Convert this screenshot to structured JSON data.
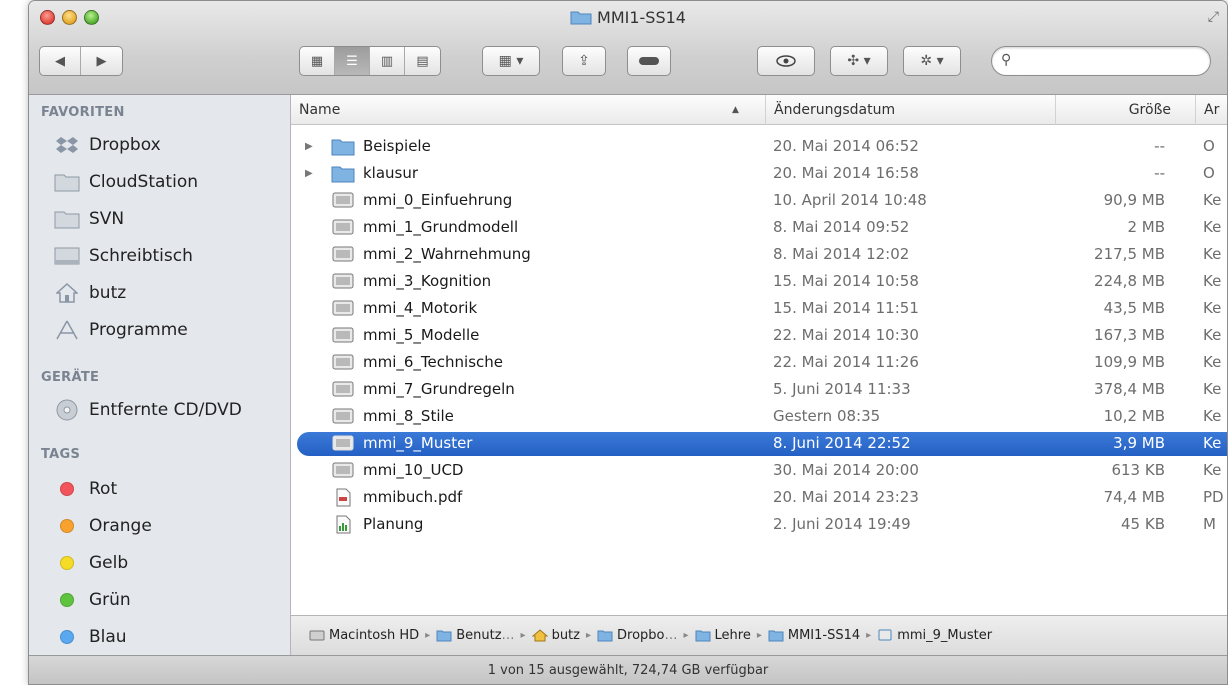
{
  "window": {
    "title": "MMI1-SS14"
  },
  "search": {
    "value": "",
    "placeholder": ""
  },
  "sidebar": {
    "sections": {
      "favorites": "FAVORITEN",
      "devices": "GERÄTE",
      "tags": "TAGS"
    },
    "favorites": [
      {
        "label": "Dropbox",
        "icon": "dropbox-icon"
      },
      {
        "label": "CloudStation",
        "icon": "folder-icon"
      },
      {
        "label": "SVN",
        "icon": "folder-icon"
      },
      {
        "label": "Schreibtisch",
        "icon": "desktop-icon"
      },
      {
        "label": "butz",
        "icon": "home-icon"
      },
      {
        "label": "Programme",
        "icon": "applications-icon"
      }
    ],
    "devices": [
      {
        "label": "Entfernte CD/DVD",
        "icon": "disc-icon"
      }
    ],
    "tags": [
      {
        "label": "Rot",
        "color": "#f2545b"
      },
      {
        "label": "Orange",
        "color": "#f7a22e"
      },
      {
        "label": "Gelb",
        "color": "#f5dc26"
      },
      {
        "label": "Grün",
        "color": "#5ec43e"
      },
      {
        "label": "Blau",
        "color": "#5aa8ef"
      }
    ]
  },
  "columns": {
    "name": "Name",
    "modified": "Änderungsdatum",
    "size": "Größe",
    "kind": "Ar"
  },
  "files": [
    {
      "name": "Beispiele",
      "date": "20. Mai 2014 06:52",
      "size": "--",
      "kind": "O",
      "type": "folder"
    },
    {
      "name": "klausur",
      "date": "20. Mai 2014 16:58",
      "size": "--",
      "kind": "O",
      "type": "folder"
    },
    {
      "name": "mmi_0_Einfuehrung",
      "date": "10. April 2014 10:48",
      "size": "90,9 MB",
      "kind": "Ke",
      "type": "keynote"
    },
    {
      "name": "mmi_1_Grundmodell",
      "date": "8. Mai 2014 09:52",
      "size": "2 MB",
      "kind": "Ke",
      "type": "keynote"
    },
    {
      "name": "mmi_2_Wahrnehmung",
      "date": "8. Mai 2014 12:02",
      "size": "217,5 MB",
      "kind": "Ke",
      "type": "keynote"
    },
    {
      "name": "mmi_3_Kognition",
      "date": "15. Mai 2014 10:58",
      "size": "224,8 MB",
      "kind": "Ke",
      "type": "keynote"
    },
    {
      "name": "mmi_4_Motorik",
      "date": "15. Mai 2014 11:51",
      "size": "43,5 MB",
      "kind": "Ke",
      "type": "keynote"
    },
    {
      "name": "mmi_5_Modelle",
      "date": "22. Mai 2014 10:30",
      "size": "167,3 MB",
      "kind": "Ke",
      "type": "keynote"
    },
    {
      "name": "mmi_6_Technische",
      "date": "22. Mai 2014 11:26",
      "size": "109,9 MB",
      "kind": "Ke",
      "type": "keynote"
    },
    {
      "name": "mmi_7_Grundregeln",
      "date": "5. Juni 2014 11:33",
      "size": "378,4 MB",
      "kind": "Ke",
      "type": "keynote"
    },
    {
      "name": "mmi_8_Stile",
      "date": "Gestern 08:35",
      "size": "10,2 MB",
      "kind": "Ke",
      "type": "keynote"
    },
    {
      "name": "mmi_9_Muster",
      "date": "8. Juni 2014 22:52",
      "size": "3,9 MB",
      "kind": "Ke",
      "type": "keynote",
      "selected": true
    },
    {
      "name": "mmi_10_UCD",
      "date": "30. Mai 2014 20:00",
      "size": "613 KB",
      "kind": "Ke",
      "type": "keynote"
    },
    {
      "name": "mmibuch.pdf",
      "date": "20. Mai 2014 23:23",
      "size": "74,4 MB",
      "kind": "PD",
      "type": "pdf"
    },
    {
      "name": "Planung",
      "date": "2. Juni 2014 19:49",
      "size": "45 KB",
      "kind": "M",
      "type": "numbers"
    }
  ],
  "pathbar": [
    {
      "label": "Macintosh HD",
      "icon": "hard-drive-icon"
    },
    {
      "label": "Benutz",
      "icon": "folder-icon",
      "truncated": true
    },
    {
      "label": "butz",
      "icon": "home-icon"
    },
    {
      "label": "Dropbo",
      "icon": "folder-icon",
      "truncated": true
    },
    {
      "label": "Lehre",
      "icon": "folder-icon"
    },
    {
      "label": "MMI1-SS14",
      "icon": "folder-icon"
    },
    {
      "label": "mmi_9_Muster",
      "icon": "keynote-icon"
    }
  ],
  "status": {
    "text": "1 von 15 ausgewählt, 724,74 GB verfügbar"
  },
  "colors": {
    "selection": "#2f6fd0",
    "sidebar": "#e4e7ec",
    "folder": "#7fb3e2"
  }
}
